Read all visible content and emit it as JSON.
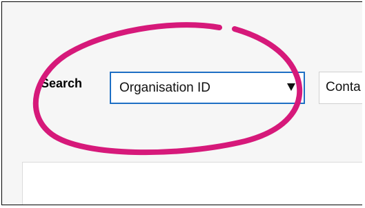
{
  "search": {
    "label": "Search",
    "field_select": {
      "value": "Organisation ID",
      "icon": "dropdown-arrow-icon"
    },
    "condition_select": {
      "value": "Conta"
    }
  },
  "colors": {
    "annotation_circle": "#d6197a",
    "focus_border": "#1e6fc4"
  }
}
